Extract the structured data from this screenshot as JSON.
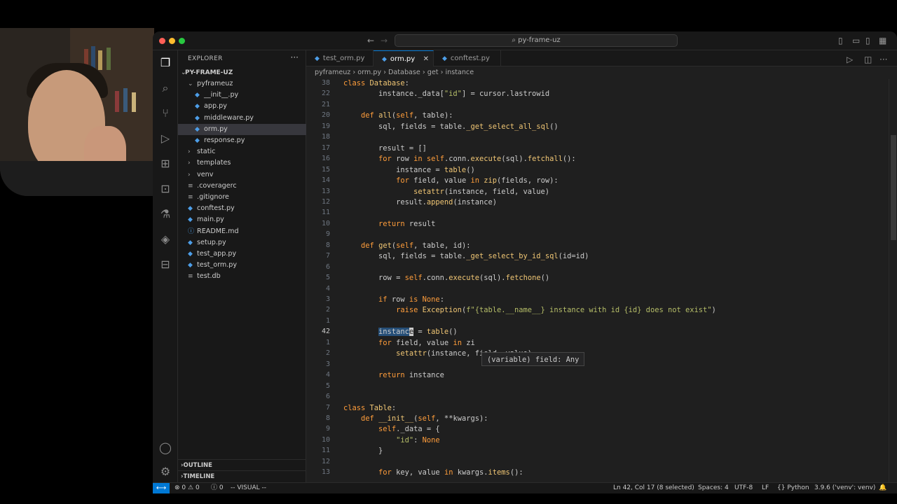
{
  "window": {
    "command_center": "py-frame-uz"
  },
  "explorer": {
    "title": "EXPLORER",
    "root": "PY-FRAME-UZ",
    "items": [
      {
        "label": "pyframeuz",
        "kind": "folder-open",
        "indent": 1
      },
      {
        "label": "__init__.py",
        "kind": "py",
        "indent": 2
      },
      {
        "label": "app.py",
        "kind": "py",
        "indent": 2
      },
      {
        "label": "middleware.py",
        "kind": "py",
        "indent": 2
      },
      {
        "label": "orm.py",
        "kind": "py",
        "indent": 2,
        "selected": true
      },
      {
        "label": "response.py",
        "kind": "py",
        "indent": 2
      },
      {
        "label": "static",
        "kind": "folder",
        "indent": 1
      },
      {
        "label": "templates",
        "kind": "folder",
        "indent": 1
      },
      {
        "label": "venv",
        "kind": "folder",
        "indent": 1
      },
      {
        "label": ".coveragerc",
        "kind": "file",
        "indent": 1
      },
      {
        "label": ".gitignore",
        "kind": "file",
        "indent": 1
      },
      {
        "label": "conftest.py",
        "kind": "py",
        "indent": 1
      },
      {
        "label": "main.py",
        "kind": "py",
        "indent": 1
      },
      {
        "label": "README.md",
        "kind": "md",
        "indent": 1
      },
      {
        "label": "setup.py",
        "kind": "py",
        "indent": 1
      },
      {
        "label": "test_app.py",
        "kind": "py",
        "indent": 1
      },
      {
        "label": "test_orm.py",
        "kind": "py",
        "indent": 1
      },
      {
        "label": "test.db",
        "kind": "db",
        "indent": 1
      }
    ],
    "outline": "OUTLINE",
    "timeline": "TIMELINE"
  },
  "tabs": [
    {
      "label": "test_orm.py",
      "active": false
    },
    {
      "label": "orm.py",
      "active": true
    },
    {
      "label": "conftest.py",
      "active": false
    }
  ],
  "breadcrumbs": [
    "pyframeuz",
    "orm.py",
    "Database",
    "get",
    "instance"
  ],
  "code": {
    "lines": [
      {
        "n": "38",
        "t": "class Database:"
      },
      {
        "n": "22",
        "t": "        instance._data[\"id\"] = cursor.lastrowid"
      },
      {
        "n": "21",
        "t": ""
      },
      {
        "n": "20",
        "t": "    def all(self, table):"
      },
      {
        "n": "19",
        "t": "        sql, fields = table._get_select_all_sql()"
      },
      {
        "n": "18",
        "t": ""
      },
      {
        "n": "17",
        "t": "        result = []"
      },
      {
        "n": "16",
        "t": "        for row in self.conn.execute(sql).fetchall():"
      },
      {
        "n": "15",
        "t": "            instance = table()"
      },
      {
        "n": "14",
        "t": "            for field, value in zip(fields, row):"
      },
      {
        "n": "13",
        "t": "                setattr(instance, field, value)"
      },
      {
        "n": "12",
        "t": "            result.append(instance)"
      },
      {
        "n": "11",
        "t": ""
      },
      {
        "n": "10",
        "t": "        return result"
      },
      {
        "n": "9",
        "t": ""
      },
      {
        "n": "8",
        "t": "    def get(self, table, id):"
      },
      {
        "n": "7",
        "t": "        sql, fields = table._get_select_by_id_sql(id=id)"
      },
      {
        "n": "6",
        "t": ""
      },
      {
        "n": "5",
        "t": "        row = self.conn.execute(sql).fetchone()"
      },
      {
        "n": "4",
        "t": ""
      },
      {
        "n": "3",
        "t": "        if row is None:"
      },
      {
        "n": "2",
        "t": "            raise Exception(f\"{table.__name__} instance with id {id} does not exist\")"
      },
      {
        "n": "1",
        "t": ""
      },
      {
        "n": "42",
        "t": "        instanc  = table()",
        "current": true
      },
      {
        "n": "1",
        "t": "        for field, value in zi"
      },
      {
        "n": "2",
        "t": "            setattr(instance, field, value)"
      },
      {
        "n": "3",
        "t": ""
      },
      {
        "n": "4",
        "t": "        return instance"
      },
      {
        "n": "5",
        "t": ""
      },
      {
        "n": "6",
        "t": ""
      },
      {
        "n": "7",
        "t": "class Table:"
      },
      {
        "n": "8",
        "t": "    def __init__(self, **kwargs):"
      },
      {
        "n": "9",
        "t": "        self._data = {"
      },
      {
        "n": "10",
        "t": "            \"id\": None"
      },
      {
        "n": "11",
        "t": "        }"
      },
      {
        "n": "12",
        "t": ""
      },
      {
        "n": "13",
        "t": "        for key, value in kwargs.items():"
      }
    ]
  },
  "hover": "(variable) field: Any",
  "status": {
    "errors": "0",
    "warnings": "0",
    "info": "0",
    "mode": "-- VISUAL --",
    "position": "Ln 42, Col 17 (8 selected)",
    "spaces": "Spaces: 4",
    "encoding": "UTF-8",
    "eol": "LF",
    "language": "Python",
    "interpreter": "3.9.6 ('venv': venv)"
  }
}
